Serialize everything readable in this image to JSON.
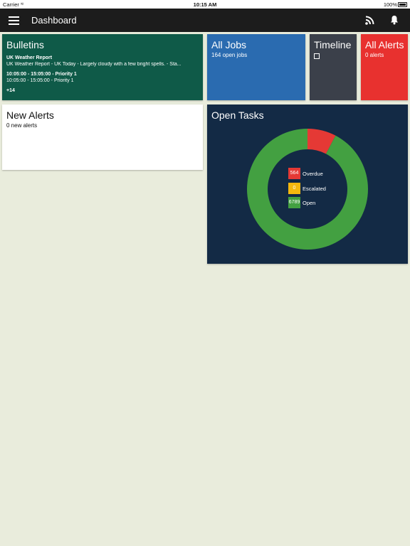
{
  "status_bar": {
    "carrier": "Carrier",
    "time": "10:15 AM",
    "battery": "100%"
  },
  "app_bar": {
    "title": "Dashboard",
    "icons": [
      "menu-icon",
      "rss-icon",
      "bell-icon"
    ]
  },
  "bulletins": {
    "title": "Bulletins",
    "items": [
      {
        "heading": "UK Weather Report",
        "text": "UK Weather Report - UK Today - Largely cloudy with a few bright spells. - Sta..."
      },
      {
        "heading": "10:05:00 - 15:05:00 - Priority 1",
        "text": "10:05:00 - 15:05:00 - Priority 1"
      }
    ],
    "more": "+14",
    "color": "#0f5a48"
  },
  "all_jobs": {
    "title": "All Jobs",
    "subtitle": "164 open jobs",
    "color": "#2a6bb0"
  },
  "timeline": {
    "title": "Timeline",
    "color": "#3b404a"
  },
  "all_alerts": {
    "title": "All Alerts",
    "subtitle": "0 alerts",
    "color": "#e8312f"
  },
  "new_alerts": {
    "title": "New Alerts",
    "subtitle": "0 new alerts"
  },
  "open_tasks": {
    "title": "Open Tasks",
    "color": "#132a45"
  },
  "chart_data": {
    "type": "pie",
    "style": "donut",
    "slices": [
      {
        "label": "Overdue",
        "value": 564,
        "color": "#e53935"
      },
      {
        "label": "Escalated",
        "value": 0,
        "color": "#f5b80e"
      },
      {
        "label": "Open",
        "value": 6789,
        "color": "#43a041"
      }
    ],
    "legend_position": "center"
  }
}
